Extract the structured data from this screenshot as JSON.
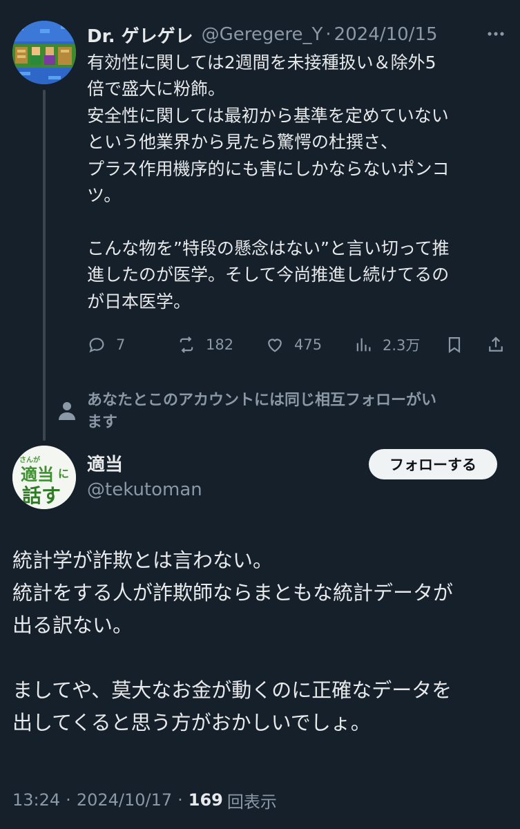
{
  "parent_tweet": {
    "author_name": "Dr. ゲレゲレ",
    "handle": "@Geregere_Y",
    "separator": "·",
    "date": "2024/10/15",
    "more_icon": "more-horizontal-icon",
    "body_lines": [
      "有効性に関しては2週間を未接種扱い＆除外5",
      "倍で盛大に粉飾。",
      "安全性に関しては最初から基準を定めていない",
      "という他業界から見たら驚愕の杜撰さ、",
      "プラス作用機序的にも害にしかならないポンコ",
      "ツ。",
      "",
      "こんな物を”特段の懸念はない”と言い切って推",
      "進したのが医学。そして今尚推進し続けてるの",
      "が日本医学。"
    ],
    "actions": {
      "replies": "7",
      "reposts": "182",
      "likes": "475",
      "views": "2.3万"
    }
  },
  "follow_suggestion": {
    "icon": "person-icon",
    "lines": [
      "あなたとこのアカウントには同じ相互フォローがい",
      "ます"
    ]
  },
  "main_tweet": {
    "author_name": "適当",
    "handle": "@tekutoman",
    "follow_label": "フォローする",
    "body_lines": [
      "統計学が詐欺とは言わない。",
      "統計をする人が詐欺師ならまともな統計データが",
      "出る訳ない。",
      "",
      "ましてや、莫大なお金が動くのに正確なデータを",
      "出してくると思う方がおかしいでしょ。"
    ],
    "time": "13:24",
    "separator": "·",
    "date": "2024/10/17",
    "view_count": "169",
    "view_label": "回表示"
  },
  "colors": {
    "background": "#15202b",
    "primary_text": "#e7e9ea",
    "secondary_text": "#8b98a5",
    "follow_button_bg": "#eff3f4"
  }
}
